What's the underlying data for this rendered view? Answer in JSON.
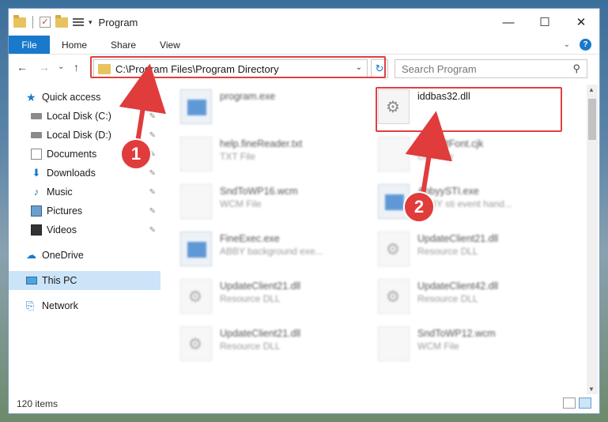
{
  "window": {
    "title": "Program",
    "controls": {
      "minimize": "—",
      "maximize": "☐",
      "close": "✕"
    }
  },
  "ribbon": {
    "tabs": [
      "File",
      "Home",
      "Share",
      "View"
    ],
    "collapse_icon": "chevron-down-icon",
    "help_label": "?"
  },
  "nav": {
    "back": "←",
    "forward": "→",
    "recent": "⌄",
    "up": "↑",
    "address": "C:\\Program Files\\Program Directory",
    "address_dropdown": "⌄",
    "refresh": "↻",
    "search_placeholder": "Search Program",
    "search_icon": "⚲"
  },
  "sidebar": {
    "items": [
      {
        "label": "Quick access",
        "icon": "star-icon",
        "pinned": false
      },
      {
        "label": "Local Disk (C:)",
        "icon": "drive-icon",
        "pinned": true
      },
      {
        "label": "Local Disk (D:)",
        "icon": "drive-icon",
        "pinned": true
      },
      {
        "label": "Documents",
        "icon": "documents-icon",
        "pinned": true
      },
      {
        "label": "Downloads",
        "icon": "download-icon",
        "pinned": true
      },
      {
        "label": "Music",
        "icon": "music-icon",
        "pinned": true
      },
      {
        "label": "Pictures",
        "icon": "pictures-icon",
        "pinned": true
      },
      {
        "label": "Videos",
        "icon": "videos-icon",
        "pinned": true
      },
      {
        "label": "OneDrive",
        "icon": "cloud-icon",
        "pinned": false
      },
      {
        "label": "This PC",
        "icon": "computer-icon",
        "pinned": false,
        "selected": true
      },
      {
        "label": "Network",
        "icon": "network-icon",
        "pinned": false
      }
    ],
    "pin_glyph": "📌"
  },
  "files": [
    {
      "name": "program.exe",
      "type": "",
      "icon": "exe",
      "blurred": true
    },
    {
      "name": "iddbas32.dll",
      "type": "",
      "icon": "dll",
      "blurred": false,
      "highlighted": true
    },
    {
      "name": "help.fineReader.txt",
      "type": "TXT File",
      "icon": "doc",
      "blurred": true
    },
    {
      "name": "DefaultFont.cjk",
      "type": "CJK File",
      "icon": "doc",
      "blurred": true
    },
    {
      "name": "SndToWP16.wcm",
      "type": "WCM File",
      "icon": "doc",
      "blurred": true
    },
    {
      "name": "AbbyySTI.exe",
      "type": "ABBY sti event hand...",
      "icon": "exe",
      "blurred": true
    },
    {
      "name": "FineExec.exe",
      "type": "ABBY background exe...",
      "icon": "exe",
      "blurred": true
    },
    {
      "name": "UpdateClient21.dll",
      "type": "Resource DLL",
      "icon": "dll",
      "blurred": true
    },
    {
      "name": "UpdateClient21.dll",
      "type": "Resource DLL",
      "icon": "dll",
      "blurred": true
    },
    {
      "name": "UpdateClient42.dll",
      "type": "Resource DLL",
      "icon": "dll",
      "blurred": true
    },
    {
      "name": "UpdateClient21.dll",
      "type": "Resource DLL",
      "icon": "dll",
      "blurred": true
    },
    {
      "name": "SndToWP12.wcm",
      "type": "WCM File",
      "icon": "doc",
      "blurred": true
    }
  ],
  "status": {
    "item_count": "120 items"
  },
  "annotations": {
    "marker1": "1",
    "marker2": "2",
    "color": "#e03c3c"
  }
}
